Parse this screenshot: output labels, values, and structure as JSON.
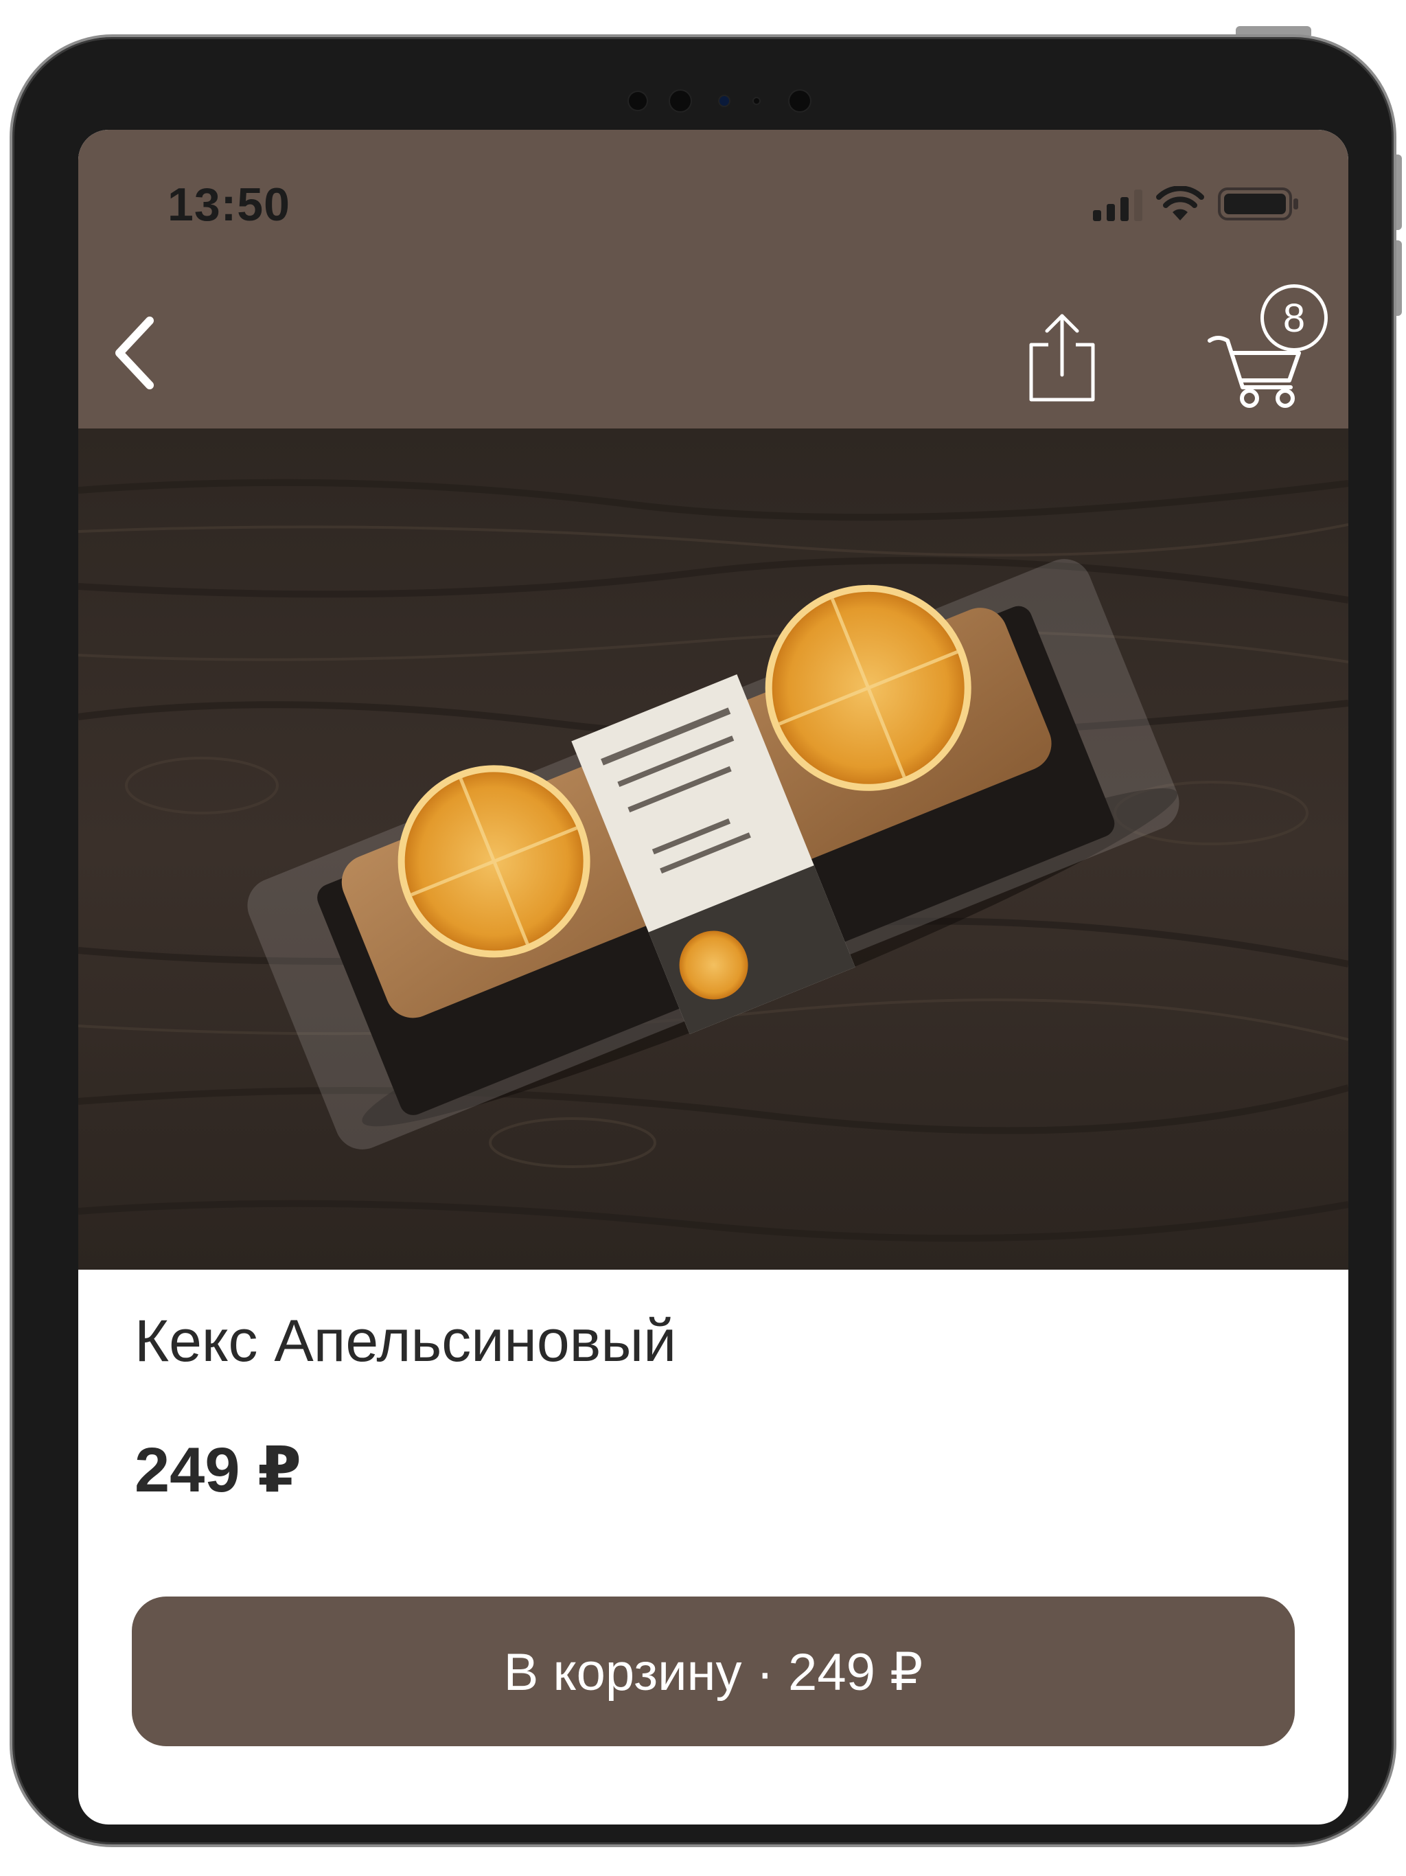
{
  "status_bar": {
    "time": "13:50",
    "icons": [
      "cellular-signal-icon",
      "wifi-icon",
      "battery-icon"
    ]
  },
  "nav": {
    "back_icon": "chevron-left-icon",
    "share_icon": "share-icon",
    "cart_icon": "cart-icon",
    "cart_count": "8"
  },
  "product": {
    "image": "product-photo",
    "title": "Кекс Апельсиновый",
    "price": "249 ₽"
  },
  "action": {
    "add_to_cart_label": "В корзину · 249 ₽"
  },
  "colors": {
    "brand": "#65554c",
    "text": "#2a2a2a",
    "on_brand": "#ffffff"
  }
}
